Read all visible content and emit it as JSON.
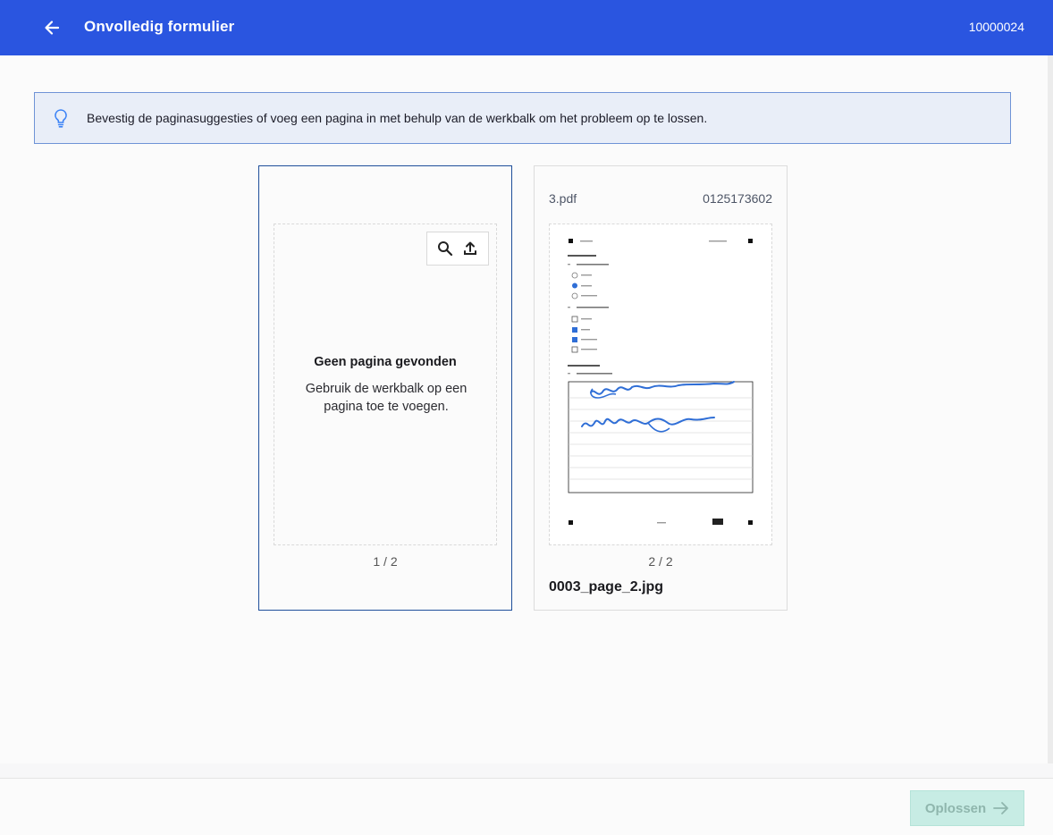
{
  "header": {
    "title": "Onvolledig formulier",
    "id": "10000024"
  },
  "banner": {
    "text": "Bevestig de paginasuggesties of voeg een pagina in met behulp van de werkbalk om het probleem op te lossen."
  },
  "cards": [
    {
      "empty_title": "Geen pagina gevonden",
      "empty_desc": "Gebruik de werkbalk op een pagina toe te voegen.",
      "page_num": "1 / 2"
    },
    {
      "file": "3.pdf",
      "number": "0125173602",
      "page_num": "2 / 2",
      "filename": "0003_page_2.jpg"
    }
  ],
  "footer": {
    "resolve_label": "Oplossen"
  },
  "colors": {
    "header_bg": "#2a55e0",
    "selected_border": "#1f4f9a",
    "resolve_bg_disabled": "#c7ece4"
  }
}
